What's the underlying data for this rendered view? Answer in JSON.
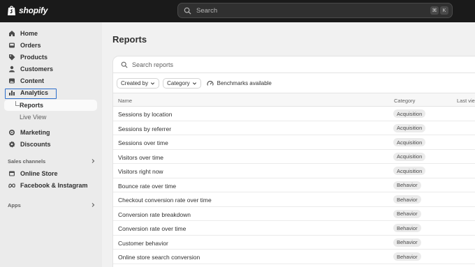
{
  "brand": {
    "name": "shopify"
  },
  "topbar": {
    "search_placeholder": "Search",
    "shortcut_keys": [
      "⌘",
      "K"
    ]
  },
  "sidebar": {
    "items": [
      {
        "label": "Home",
        "icon": "home-icon"
      },
      {
        "label": "Orders",
        "icon": "inbox-icon"
      },
      {
        "label": "Products",
        "icon": "tag-icon"
      },
      {
        "label": "Customers",
        "icon": "person-icon"
      },
      {
        "label": "Content",
        "icon": "image-icon"
      },
      {
        "label": "Analytics",
        "icon": "bar-chart-icon"
      }
    ],
    "analytics_sub": [
      {
        "label": "Reports",
        "active": true
      },
      {
        "label": "Live View",
        "active": false
      }
    ],
    "items2": [
      {
        "label": "Marketing",
        "icon": "target-icon"
      },
      {
        "label": "Discounts",
        "icon": "discount-icon"
      }
    ],
    "sales_channels_header": "Sales channels",
    "channels": [
      {
        "label": "Online Store",
        "icon": "store-icon"
      },
      {
        "label": "Facebook & Instagram",
        "icon": "meta-icon"
      }
    ],
    "apps_header": "Apps"
  },
  "main": {
    "title": "Reports",
    "search_placeholder": "Search reports",
    "filters": {
      "created_by": "Created by",
      "category": "Category",
      "benchmarks": "Benchmarks available"
    },
    "columns": {
      "name": "Name",
      "category": "Category",
      "last_viewed": "Last vie"
    },
    "rows": [
      {
        "name": "Sessions by location",
        "category": "Acquisition"
      },
      {
        "name": "Sessions by referrer",
        "category": "Acquisition"
      },
      {
        "name": "Sessions over time",
        "category": "Acquisition"
      },
      {
        "name": "Visitors over time",
        "category": "Acquisition"
      },
      {
        "name": "Visitors right now",
        "category": "Acquisition"
      },
      {
        "name": "Bounce rate over time",
        "category": "Behavior"
      },
      {
        "name": "Checkout conversion rate over time",
        "category": "Behavior"
      },
      {
        "name": "Conversion rate breakdown",
        "category": "Behavior"
      },
      {
        "name": "Conversion rate over time",
        "category": "Behavior"
      },
      {
        "name": "Customer behavior",
        "category": "Behavior"
      },
      {
        "name": "Online store search conversion",
        "category": "Behavior"
      }
    ]
  },
  "colors": {
    "topbar": "#1a1a1a",
    "sidebar": "#ebebeb",
    "highlight": "#2c6ecb",
    "badge": "#ebebeb"
  }
}
